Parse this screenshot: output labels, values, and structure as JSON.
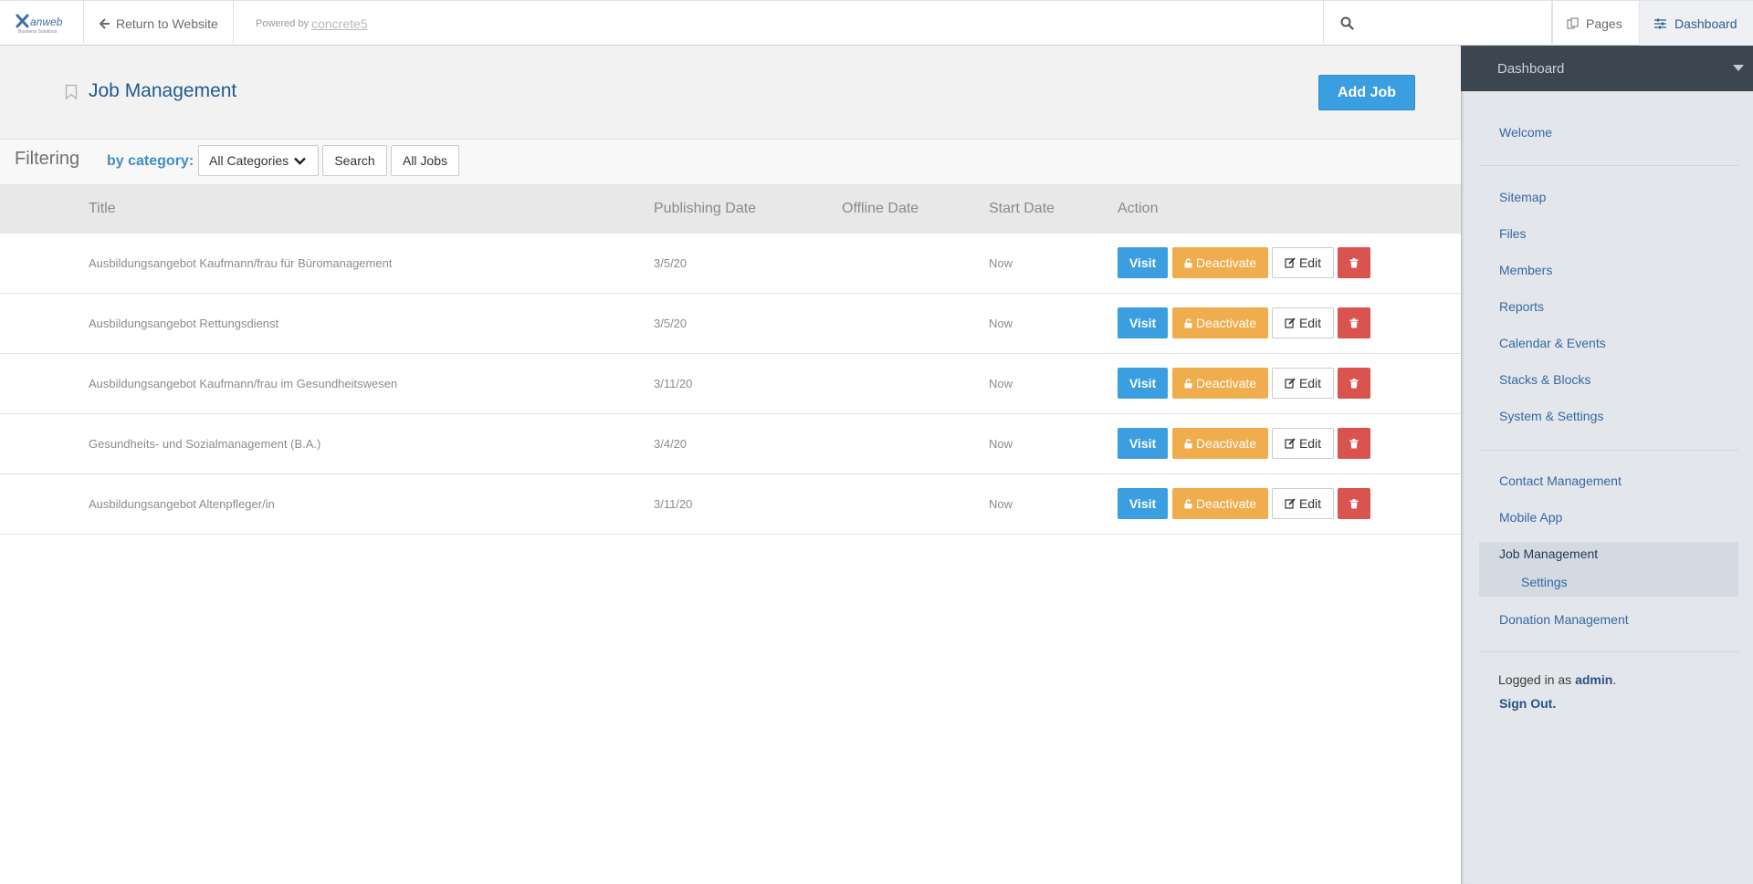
{
  "toolbar": {
    "logo_text": "anweb",
    "logo_sub": "Business Solutions",
    "return_label": "Return to Website",
    "powered_by": "Powered by",
    "powered_brand": "concrete5",
    "pages_label": "Pages",
    "dashboard_label": "Dashboard"
  },
  "header": {
    "title": "Job Management",
    "add_job_label": "Add Job"
  },
  "filter": {
    "label": "Filtering",
    "category_label": "by category:",
    "category_value": "All Categories",
    "search_label": "Search",
    "all_jobs_label": "All Jobs"
  },
  "table": {
    "columns": [
      "Title",
      "Publishing Date",
      "Offline Date",
      "Start Date",
      "Action"
    ],
    "rows": [
      {
        "title": "Ausbildungsangebot Kaufmann/frau für Büromanagement",
        "publishing": "3/5/20",
        "offline": "",
        "start": "Now"
      },
      {
        "title": "Ausbildungsangebot Rettungsdienst",
        "publishing": "3/5/20",
        "offline": "",
        "start": "Now"
      },
      {
        "title": "Ausbildungsangebot Kaufmann/frau im Gesundheitswesen",
        "publishing": "3/11/20",
        "offline": "",
        "start": "Now"
      },
      {
        "title": "Gesundheits- und Sozialmanagement (B.A.)",
        "publishing": "3/4/20",
        "offline": "",
        "start": "Now"
      },
      {
        "title": "Ausbildungsangebot Altenpfleger/in",
        "publishing": "3/11/20",
        "offline": "",
        "start": "Now"
      }
    ],
    "actions": {
      "visit": "Visit",
      "deactivate": "Deactivate",
      "edit": "Edit"
    }
  },
  "panel": {
    "title": "Dashboard",
    "items": {
      "welcome": "Welcome",
      "sitemap": "Sitemap",
      "files": "Files",
      "members": "Members",
      "reports": "Reports",
      "calendar": "Calendar & Events",
      "stacks": "Stacks & Blocks",
      "system": "System & Settings",
      "contact": "Contact Management",
      "mobile": "Mobile App",
      "jobs": "Job Management",
      "jobs_settings": "Settings",
      "donation": "Donation Management"
    },
    "logged_in_prefix": "Logged in as",
    "user": "admin",
    "logged_in_suffix": ".",
    "sign_out": "Sign Out."
  },
  "colors": {
    "primary": "#3a9ee0",
    "warning": "#f0ad4e",
    "danger": "#d9534f",
    "title_blue": "#1f5a93",
    "panel_dark": "#3b4650"
  }
}
